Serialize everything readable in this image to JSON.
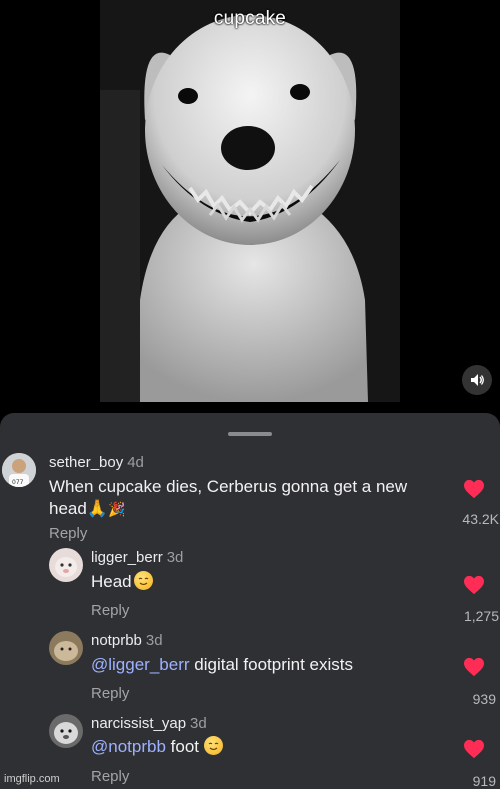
{
  "video": {
    "title": "cupcake",
    "sound_icon": "speaker-icon"
  },
  "comments": [
    {
      "username": "sether_boy",
      "time": "4d",
      "text": "When cupcake dies, Cerberus gonna get a new head",
      "emoji": [
        "folded-hands-emoji",
        "party-popper-emoji"
      ],
      "reply": "Reply",
      "likes": "43.2K"
    },
    {
      "username": "ligger_berr",
      "time": "3d",
      "text": "Head",
      "emoji": [
        "relieved-face-emoji"
      ],
      "reply": "Reply",
      "likes": "1,275"
    },
    {
      "username": "notprbb",
      "time": "3d",
      "mention": "@ligger_berr",
      "text": " digital footprint exists",
      "reply": "Reply",
      "likes": "939"
    },
    {
      "username": "narcissist_yap",
      "time": "3d",
      "mention": "@notprbb",
      "text": " foot ",
      "emoji": [
        "relieved-face-emoji"
      ],
      "reply": "Reply",
      "likes": "919"
    }
  ],
  "watermark": "imgflip.com",
  "colors": {
    "sheet_bg": "#2f3034",
    "like_red": "#ff2d55",
    "mention": "#9db1ff"
  }
}
